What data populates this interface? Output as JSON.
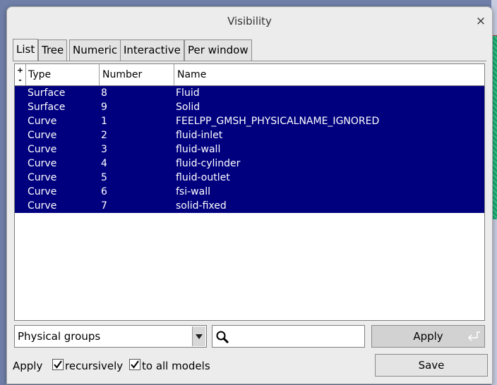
{
  "window": {
    "title": "Visibility",
    "close_glyph": "×"
  },
  "tabs": [
    {
      "label": "List",
      "active": true
    },
    {
      "label": "Tree",
      "active": false
    },
    {
      "label": "Numeric",
      "active": false
    },
    {
      "label": "Interactive",
      "active": false
    },
    {
      "label": "Per window",
      "active": false
    }
  ],
  "table": {
    "plus": "+",
    "minus": "-",
    "columns": [
      "Type",
      "Number",
      "Name"
    ],
    "rows": [
      {
        "type": "Surface",
        "number": "8",
        "name": "Fluid"
      },
      {
        "type": "Surface",
        "number": "9",
        "name": "Solid"
      },
      {
        "type": "Curve",
        "number": "1",
        "name": "FEELPP_GMSH_PHYSICALNAME_IGNORED"
      },
      {
        "type": "Curve",
        "number": "2",
        "name": "fluid-inlet"
      },
      {
        "type": "Curve",
        "number": "3",
        "name": "fluid-wall"
      },
      {
        "type": "Curve",
        "number": "4",
        "name": "fluid-cylinder"
      },
      {
        "type": "Curve",
        "number": "5",
        "name": "fluid-outlet"
      },
      {
        "type": "Curve",
        "number": "6",
        "name": "fsi-wall"
      },
      {
        "type": "Curve",
        "number": "7",
        "name": "solid-fixed"
      }
    ],
    "selection_color": "#00007f"
  },
  "filter": {
    "select_value": "Physical groups",
    "search_value": ""
  },
  "buttons": {
    "apply": "Apply",
    "save": "Save"
  },
  "footer": {
    "apply_label": "Apply",
    "recursively_label": "recursively",
    "recursively_checked": true,
    "all_models_label": "to all models",
    "all_models_checked": true
  }
}
